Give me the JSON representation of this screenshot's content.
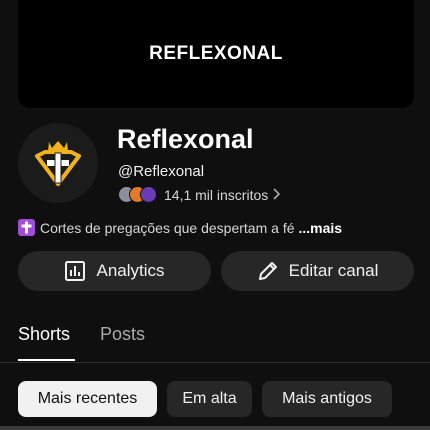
{
  "banner": {
    "text": "REFLEXONAL"
  },
  "channel": {
    "name": "Reflexonal",
    "handle": "@Reflexonal",
    "subscribers": "14,1 mil inscritos",
    "description": "Cortes de pregações que despertam a fé",
    "more_label": "...mais"
  },
  "actions": {
    "analytics_label": "Analytics",
    "edit_label": "Editar canal"
  },
  "tabs": [
    {
      "label": "Shorts",
      "active": true
    },
    {
      "label": "Posts",
      "active": false
    }
  ],
  "filters": [
    {
      "label": "Mais recentes",
      "active": true
    },
    {
      "label": "Em alta",
      "active": false
    },
    {
      "label": "Mais antigos",
      "active": false
    }
  ],
  "icons": {
    "avatar": "diamond-cross-logo",
    "subs_chevron": "chevron-right-icon",
    "description_emoji": "latin-cross-icon",
    "analytics": "bar-chart-icon",
    "edit": "pencil-icon"
  },
  "colors": {
    "background": "#0f0f0f",
    "button_bg": "#272727",
    "logo_gold": "#f2b21c",
    "emoji_purple": "#a24dd6"
  }
}
